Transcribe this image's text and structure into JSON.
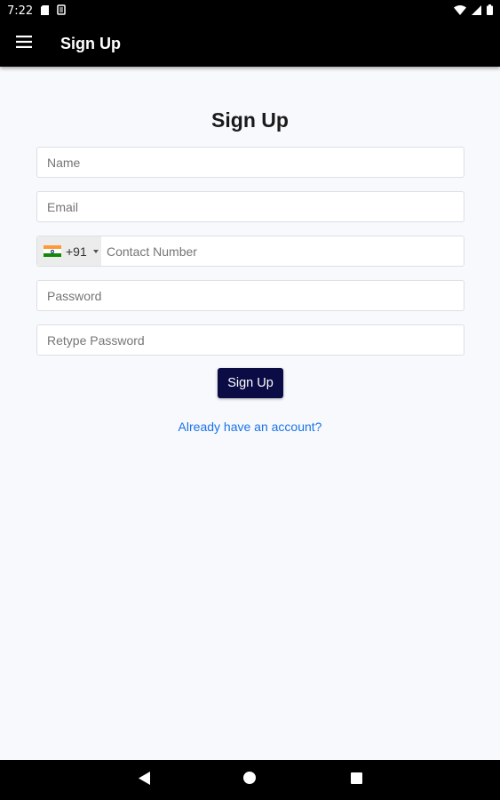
{
  "status_bar": {
    "time": "7:22",
    "icons": [
      "sd-card-icon",
      "storage-icon",
      "wifi-icon",
      "signal-icon",
      "battery-icon"
    ]
  },
  "app_bar": {
    "title": "Sign Up",
    "menu_icon": "hamburger-menu-icon"
  },
  "form": {
    "title": "Sign Up",
    "name_placeholder": "Name",
    "email_placeholder": "Email",
    "phone": {
      "country_flag": "india-flag-icon",
      "dial_code": "+91",
      "placeholder": "Contact Number"
    },
    "password_placeholder": "Password",
    "retype_password_placeholder": "Retype Password",
    "submit_label": "Sign Up",
    "login_link": "Already have an account?"
  },
  "nav_bar": {
    "icons": [
      "back-icon",
      "home-icon",
      "recents-icon"
    ]
  },
  "colors": {
    "app_bar": "#000000",
    "background": "#f7f9fc",
    "button": "#0b0b45",
    "link": "#1a73e8"
  }
}
